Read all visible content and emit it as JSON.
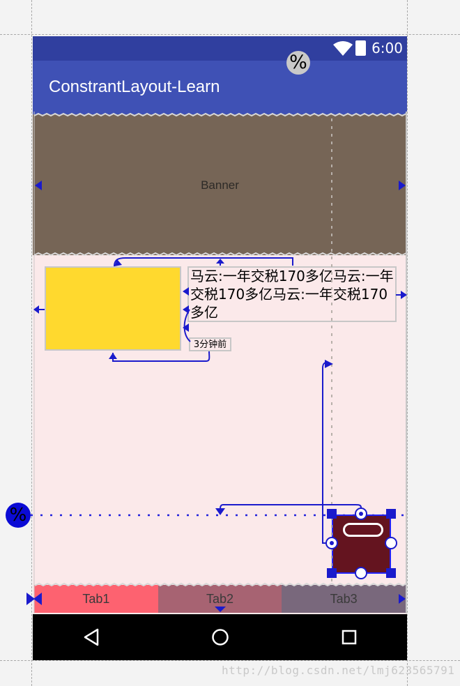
{
  "status_bar": {
    "time": "6:00"
  },
  "app_bar": {
    "title": "ConstrantLayout-Learn"
  },
  "guideline_badges": {
    "top": "%",
    "left": "%"
  },
  "banner": {
    "label": "Banner"
  },
  "news": {
    "text": "马云:一年交税170多亿马云:一年交税170多亿马云:一年交税170多亿",
    "time": "3分钟前"
  },
  "tabs": [
    {
      "label": "Tab1"
    },
    {
      "label": "Tab2"
    },
    {
      "label": "Tab3"
    }
  ],
  "watermark": "http://blog.csdn.net/lmj623565791",
  "colors": {
    "status_bar": "#303f9f",
    "app_bar": "#3f51b5",
    "banner": "#766556",
    "content_bg": "#fbe9ea",
    "image_placeholder": "#ffd92e",
    "selected_widget": "#64141f",
    "constraint_blue": "#1a1acc",
    "tab1": "#fd6270",
    "tab2": "#a76372",
    "tab3": "#79687c"
  },
  "icons": {
    "status": [
      "wifi-icon",
      "battery-icon"
    ],
    "navigation": [
      "back-icon",
      "home-icon",
      "recents-icon"
    ]
  }
}
